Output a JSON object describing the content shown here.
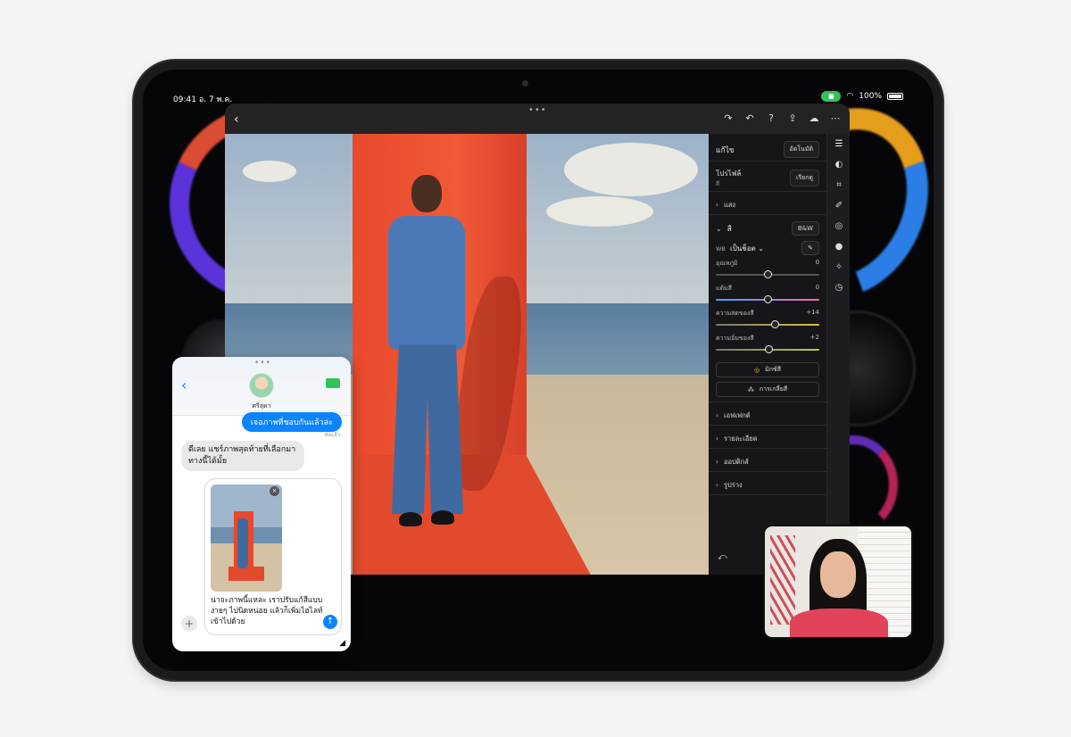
{
  "status": {
    "time": "09:41",
    "date": "อ. 7 พ.ค.",
    "battery": "100%"
  },
  "editor": {
    "panel_title": "แก้ไข",
    "auto_btn": "อัตโนมัติ",
    "profile_label": "โปรไฟล์",
    "profile_value": "สี",
    "browse_btn": "เรียกดู",
    "light_section": "แสง",
    "color_section": "สี",
    "bw_btn": "B&W",
    "wb_label": "WB",
    "wb_value": "เป็นช็อต",
    "sliders": [
      {
        "label": "อุณหภูมิ",
        "value": "0",
        "pos": 0.5
      },
      {
        "label": "แต้มสี",
        "value": "0",
        "pos": 0.5
      },
      {
        "label": "ความสดของสี",
        "value": "+14",
        "pos": 0.57
      },
      {
        "label": "ความอิ่มของสี",
        "value": "+2",
        "pos": 0.51
      }
    ],
    "mix_btn": "มิกซ์สี",
    "grade_btn": "การเกลี่ยสี",
    "sections": [
      "เอฟเฟกต์",
      "รายละเอียด",
      "ออปติกส์",
      "รูปร่าง"
    ]
  },
  "messages": {
    "contact": "ศรีสุดา",
    "out_msg": "เจอภาพที่ชอบกันแล้วล่ะ",
    "sent_label": "ส่งแล้ว",
    "in_msg": "ดีเลย แชร์ภาพสุดท้ายที่เลือกมาทางนี้ได้มั้ย",
    "compose_text": "น่าจะภาพนี้แหละ เราปรับแก้สีแบบง่ายๆ ไปนิดหน่อย แล้วก็เพิ่มไฮไลท์เข้าไปด้วย"
  }
}
